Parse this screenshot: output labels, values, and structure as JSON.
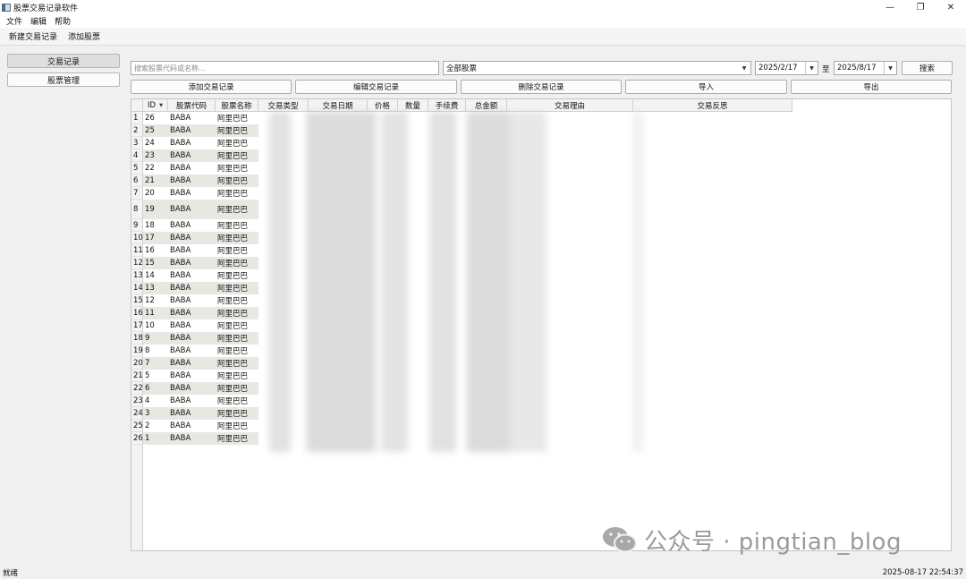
{
  "window": {
    "title": "股票交易记录软件",
    "controls": {
      "minimize": "—",
      "restore": "❐",
      "close": "✕"
    }
  },
  "menu": [
    "文件",
    "编辑",
    "帮助"
  ],
  "toolbar": [
    "新建交易记录",
    "添加股票"
  ],
  "nav": {
    "trades": "交易记录",
    "stocks": "股票管理"
  },
  "filters": {
    "search_placeholder": "搜索股票代码或名称...",
    "stock_select": "全部股票",
    "date_from": "2025/2/17",
    "date_to": "2025/8/17",
    "to_label": "至",
    "search_button": "搜索"
  },
  "actions": {
    "add": "添加交易记录",
    "edit": "编辑交易记录",
    "delete": "删除交易记录",
    "import": "导入",
    "export": "导出"
  },
  "table": {
    "columns": [
      "ID",
      "股票代码",
      "股票名称",
      "交易类型",
      "交易日期",
      "价格",
      "数量",
      "手续费",
      "总金额",
      "交易理由",
      "交易反思"
    ],
    "sort_icon": "sort-desc-icon",
    "rows": [
      {
        "n": "1",
        "id": "26",
        "code": "BABA",
        "name": "阿里巴巴"
      },
      {
        "n": "2",
        "id": "25",
        "code": "BABA",
        "name": "阿里巴巴"
      },
      {
        "n": "3",
        "id": "24",
        "code": "BABA",
        "name": "阿里巴巴"
      },
      {
        "n": "4",
        "id": "23",
        "code": "BABA",
        "name": "阿里巴巴"
      },
      {
        "n": "5",
        "id": "22",
        "code": "BABA",
        "name": "阿里巴巴"
      },
      {
        "n": "6",
        "id": "21",
        "code": "BABA",
        "name": "阿里巴巴"
      },
      {
        "n": "7",
        "id": "20",
        "code": "BABA",
        "name": "阿里巴巴"
      },
      {
        "n": "8",
        "id": "19",
        "code": "BABA",
        "name": "阿里巴巴"
      },
      {
        "n": "9",
        "id": "18",
        "code": "BABA",
        "name": "阿里巴巴"
      },
      {
        "n": "10",
        "id": "17",
        "code": "BABA",
        "name": "阿里巴巴"
      },
      {
        "n": "11",
        "id": "16",
        "code": "BABA",
        "name": "阿里巴巴"
      },
      {
        "n": "12",
        "id": "15",
        "code": "BABA",
        "name": "阿里巴巴"
      },
      {
        "n": "13",
        "id": "14",
        "code": "BABA",
        "name": "阿里巴巴"
      },
      {
        "n": "14",
        "id": "13",
        "code": "BABA",
        "name": "阿里巴巴"
      },
      {
        "n": "15",
        "id": "12",
        "code": "BABA",
        "name": "阿里巴巴"
      },
      {
        "n": "16",
        "id": "11",
        "code": "BABA",
        "name": "阿里巴巴"
      },
      {
        "n": "17",
        "id": "10",
        "code": "BABA",
        "name": "阿里巴巴"
      },
      {
        "n": "18",
        "id": "9",
        "code": "BABA",
        "name": "阿里巴巴"
      },
      {
        "n": "19",
        "id": "8",
        "code": "BABA",
        "name": "阿里巴巴"
      },
      {
        "n": "20",
        "id": "7",
        "code": "BABA",
        "name": "阿里巴巴"
      },
      {
        "n": "21",
        "id": "5",
        "code": "BABA",
        "name": "阿里巴巴"
      },
      {
        "n": "22",
        "id": "6",
        "code": "BABA",
        "name": "阿里巴巴"
      },
      {
        "n": "23",
        "id": "4",
        "code": "BABA",
        "name": "阿里巴巴"
      },
      {
        "n": "24",
        "id": "3",
        "code": "BABA",
        "name": "阿里巴巴"
      },
      {
        "n": "25",
        "id": "2",
        "code": "BABA",
        "name": "阿里巴巴"
      },
      {
        "n": "26",
        "id": "1",
        "code": "BABA",
        "name": "阿里巴巴"
      }
    ]
  },
  "watermark": "公众号 · pingtian_blog",
  "status": {
    "left": "就绪",
    "right": "2025-08-17 22:54:37"
  },
  "colors": {
    "alt_row": "#e9e7e2",
    "header_bg": "#f3f3f3"
  }
}
